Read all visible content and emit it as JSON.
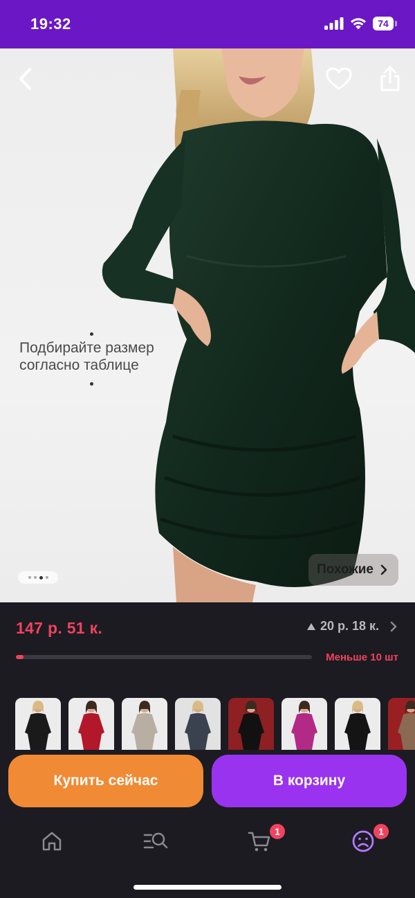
{
  "status_bar": {
    "time": "19:32",
    "battery": "74",
    "icons": [
      "signal-icon",
      "wifi-icon",
      "battery-icon"
    ]
  },
  "photo": {
    "hint_line1": "Подбирайте размер",
    "hint_line2": "согласно таблице",
    "gallery_count": 4,
    "gallery_active": 3,
    "similar_label": "Похожие",
    "icons": [
      "back-arrow-icon",
      "heart-icon",
      "share-icon",
      "chevron-right-icon"
    ]
  },
  "price": {
    "current": "147 р.  51 к.",
    "alt_price": "20 р.  18 к.",
    "sold_fraction": 0.025,
    "stock_label": "Меньше 10 шт"
  },
  "thumbnails": [
    {
      "dress": "#1a1a1a",
      "bg": "#ececec"
    },
    {
      "dress": "#b3182a",
      "bg": "#ececec"
    },
    {
      "dress": "#b8aea2",
      "bg": "#ececec"
    },
    {
      "dress": "#3a4250",
      "bg": "#e2e2e2"
    },
    {
      "dress": "#111111",
      "bg": "#8e1f22"
    },
    {
      "dress": "#b22a86",
      "bg": "#ececec"
    },
    {
      "dress": "#141414",
      "bg": "#ececec"
    },
    {
      "dress": "#8a6a52",
      "bg": "#9a1f22"
    }
  ],
  "actions": {
    "buy_now": "Купить сейчас",
    "add_to_cart": "В корзину"
  },
  "nav": {
    "items": [
      {
        "icon": "home-icon",
        "badge": ""
      },
      {
        "icon": "catalog-search-icon",
        "badge": ""
      },
      {
        "icon": "cart-icon",
        "badge": "1"
      },
      {
        "icon": "profile-icon",
        "badge": "1"
      }
    ]
  },
  "colors": {
    "status_bar": "#6b17c6",
    "price": "#f0435f",
    "buy_button": "#f18a34",
    "cart_button": "#9a33f0",
    "active_nav": "#b07bff"
  }
}
